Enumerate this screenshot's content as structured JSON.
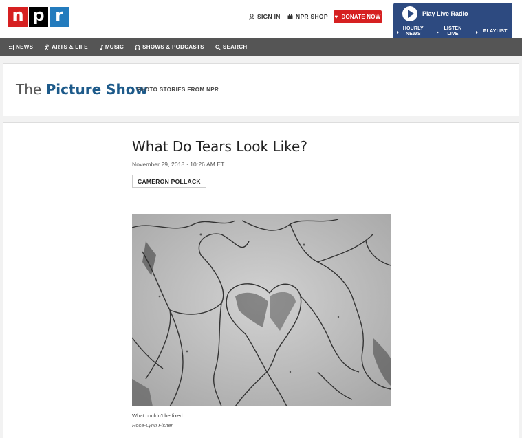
{
  "header": {
    "logo": [
      "n",
      "p",
      "r"
    ],
    "sign_in": "SIGN IN",
    "shop": "NPR SHOP",
    "donate": "DONATE NOW",
    "player": {
      "title": "Play Live Radio",
      "links": [
        "HOURLY NEWS",
        "LISTEN LIVE",
        "PLAYLIST"
      ]
    }
  },
  "nav": {
    "items": [
      {
        "label": "NEWS",
        "icon": "news-icon"
      },
      {
        "label": "ARTS & LIFE",
        "icon": "arts-icon"
      },
      {
        "label": "MUSIC",
        "icon": "music-icon"
      },
      {
        "label": "SHOWS & PODCASTS",
        "icon": "headphones-icon"
      },
      {
        "label": "SEARCH",
        "icon": "search-icon"
      }
    ]
  },
  "show": {
    "title_prefix": "The",
    "title_name": "Picture Show",
    "tagline": "PHOTO STORIES FROM NPR"
  },
  "article": {
    "headline": "What Do Tears Look Like?",
    "date": "November 29, 2018 · 10:26 AM ET",
    "byline": "CAMERON POLLACK",
    "caption": "What couldn't be fixed",
    "credit": "Rose-Lynn Fisher"
  },
  "colors": {
    "npr_red": "#d62021",
    "npr_blue": "#237bbd",
    "player_blue": "#2d4a80",
    "show_blue": "#1d5a8a"
  }
}
